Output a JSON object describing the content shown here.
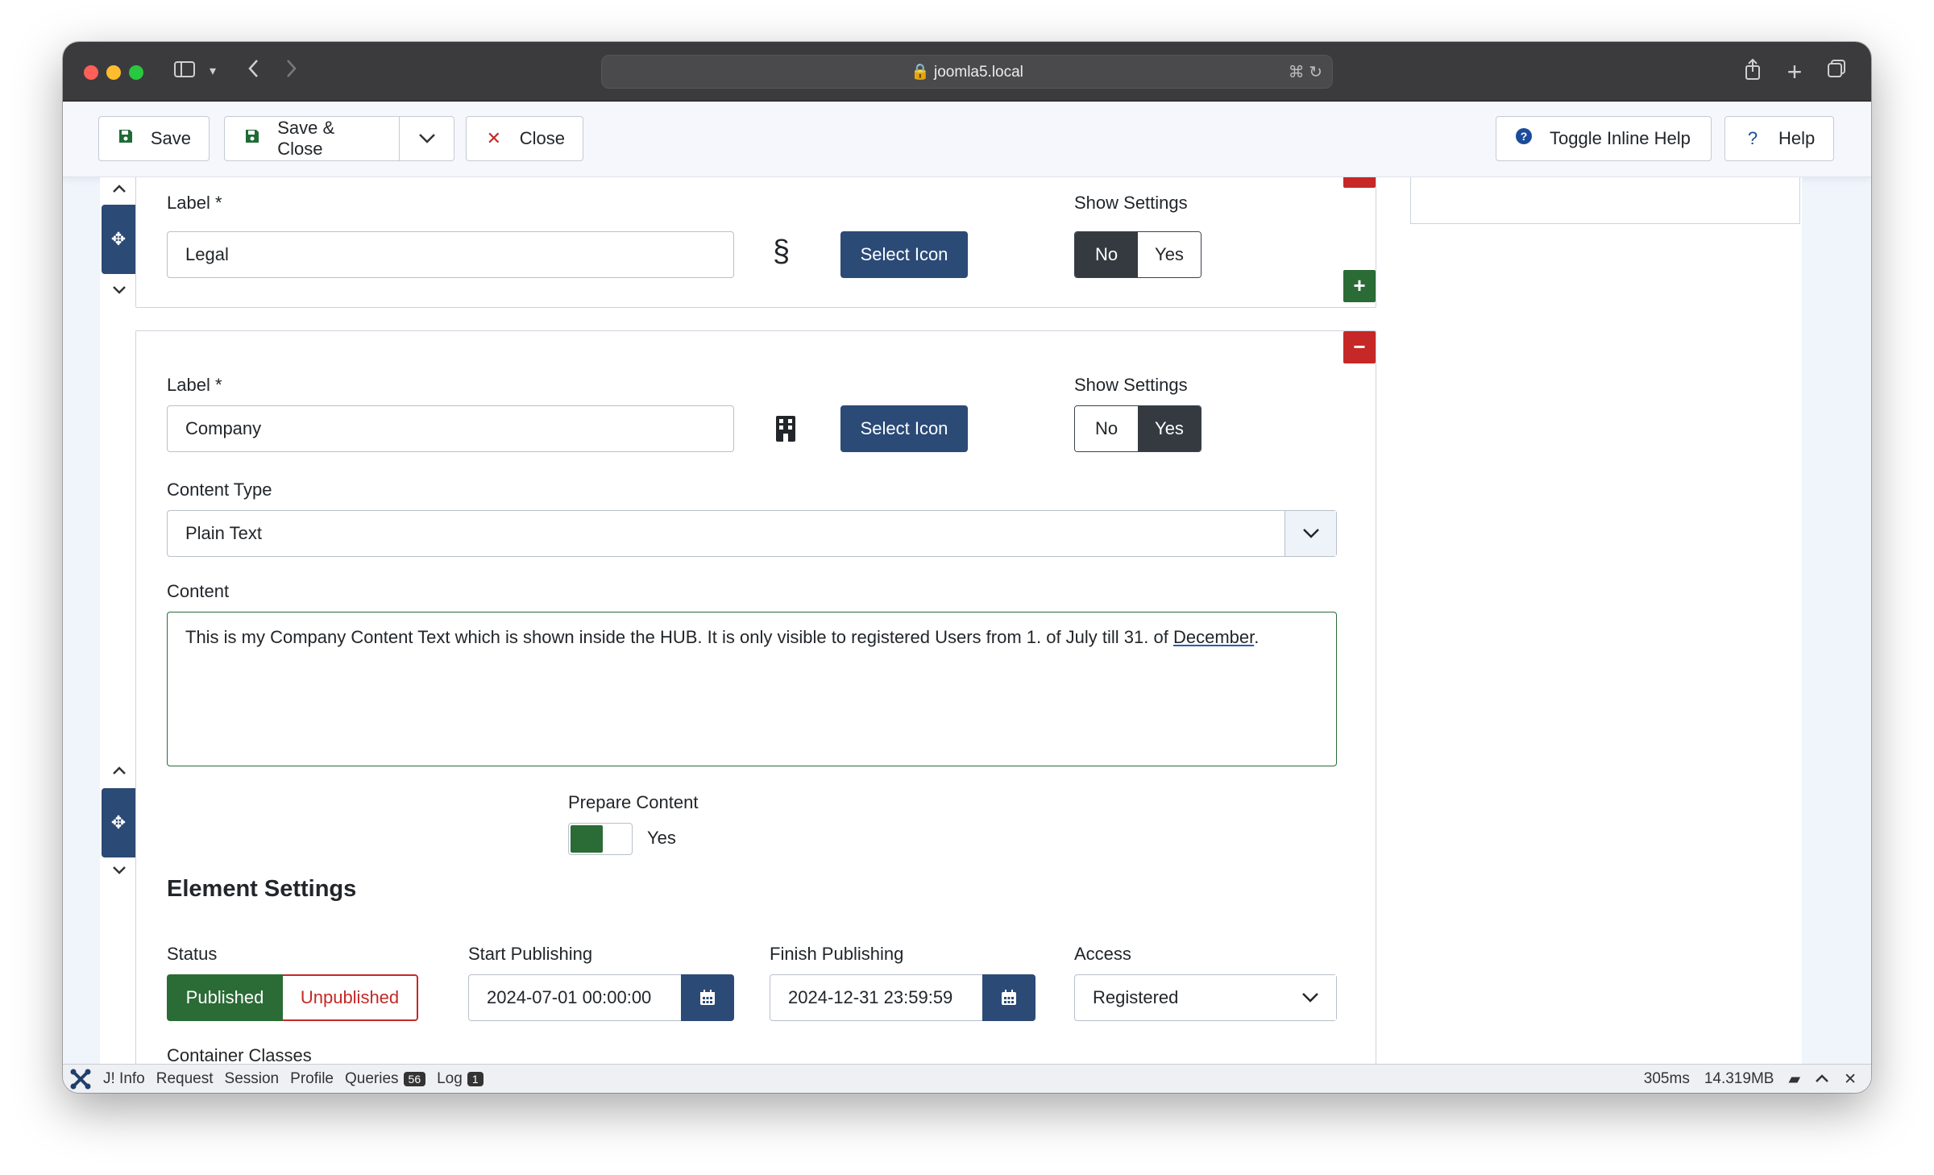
{
  "browser": {
    "url": "joomla5.local"
  },
  "toolbar": {
    "save": "Save",
    "save_close": "Save & Close",
    "close": "Close",
    "toggle_help": "Toggle Inline Help",
    "help": "Help"
  },
  "item1": {
    "label_caption": "Label *",
    "label_value": "Legal",
    "icon_glyph": "§",
    "select_icon": "Select Icon",
    "show_settings": "Show Settings",
    "no": "No",
    "yes": "Yes",
    "selected": "No"
  },
  "item2": {
    "label_caption": "Label *",
    "label_value": "Company",
    "icon_name": "building-icon",
    "select_icon": "Select Icon",
    "show_settings": "Show Settings",
    "no": "No",
    "yes": "Yes",
    "selected": "Yes",
    "content_type_caption": "Content Type",
    "content_type_value": "Plain Text",
    "content_caption": "Content",
    "content_text_a": "This is my Company Content Text which is shown inside the HUB. It is only visible to registered Users from 1. of July till 31. of ",
    "content_text_b": "December",
    "content_text_c": ".",
    "prepare_caption": "Prepare Content",
    "prepare_value": "Yes",
    "element_settings": "Element Settings",
    "status_caption": "Status",
    "published": "Published",
    "unpublished": "Unpublished",
    "start_caption": "Start Publishing",
    "start_value": "2024-07-01 00:00:00",
    "finish_caption": "Finish Publishing",
    "finish_value": "2024-12-31 23:59:59",
    "access_caption": "Access",
    "access_value": "Registered",
    "container_caption": "Container Classes"
  },
  "debug": {
    "info": "J! Info",
    "request": "Request",
    "session": "Session",
    "profile": "Profile",
    "queries": "Queries",
    "queries_count": "56",
    "log": "Log",
    "log_count": "1",
    "time": "305ms",
    "memory": "14.319MB"
  },
  "colors": {
    "primary": "#2b4a76",
    "success": "#2b6b36",
    "danger": "#c52827",
    "dark": "#343a40"
  }
}
